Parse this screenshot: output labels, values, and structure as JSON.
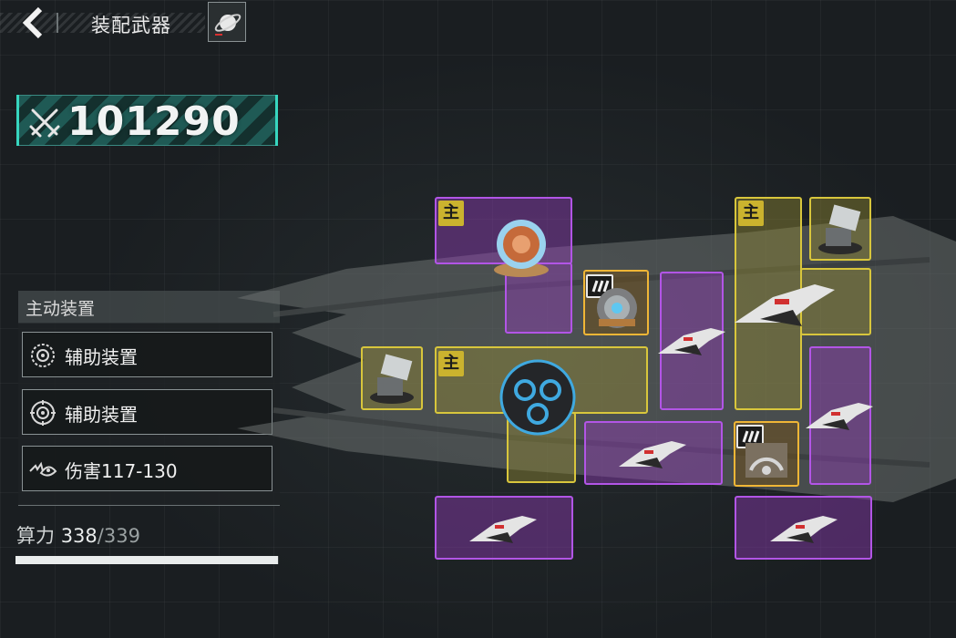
{
  "header": {
    "title": "装配武器"
  },
  "power": {
    "value": "101290"
  },
  "panel": {
    "header": "主动装置",
    "slots": [
      {
        "label": "辅助装置",
        "icon": "target-reticle-icon"
      },
      {
        "label": "辅助装置",
        "icon": "crosshair-circle-icon"
      },
      {
        "label": "伤害117-130",
        "icon": "damage-wave-icon"
      }
    ]
  },
  "compute": {
    "label": "算力",
    "current": "338",
    "separator": "/",
    "max": "339",
    "fraction": 0.997
  },
  "grid": {
    "main_tag": "主"
  },
  "colors": {
    "purple_slot": "#b255e6",
    "yellow_slot": "#d8c63c",
    "accent_teal": "#37d6bf"
  }
}
